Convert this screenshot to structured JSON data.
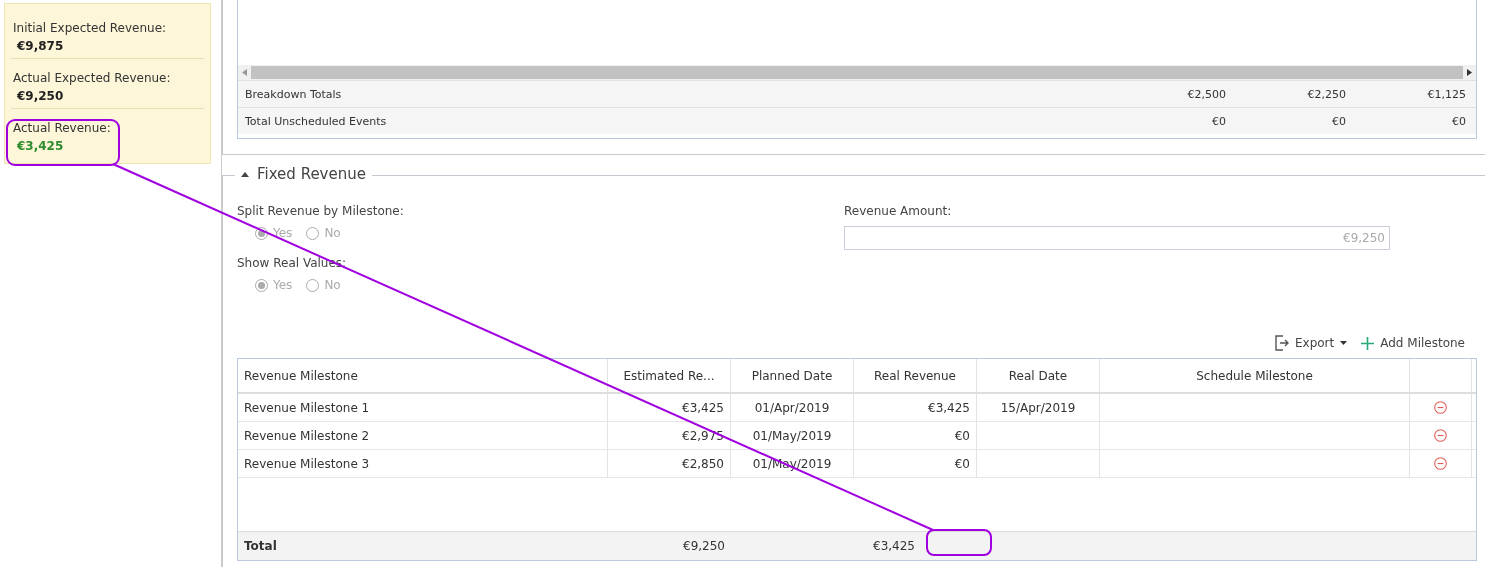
{
  "summary": [
    {
      "label": "Initial Expected Revenue:",
      "value": "€9,875",
      "highlight": false
    },
    {
      "label": "Actual Expected Revenue:",
      "value": "€9,250",
      "highlight": false
    },
    {
      "label": "Actual Revenue:",
      "value": "€3,425",
      "highlight": true
    }
  ],
  "breakdown": {
    "rows": [
      {
        "label": "Breakdown Totals",
        "values": [
          "€2,500",
          "€2,250",
          "€1,125"
        ]
      },
      {
        "label": "Total Unscheduled Events",
        "values": [
          "€0",
          "€0",
          "€0"
        ]
      }
    ]
  },
  "fixed_revenue": {
    "title": "Fixed Revenue",
    "expanded": true,
    "split_by_milestone": {
      "label": "Split Revenue by Milestone:",
      "disabled": true,
      "options": [
        {
          "label": "Yes",
          "selected": true
        },
        {
          "label": "No",
          "selected": false
        }
      ]
    },
    "show_real_values": {
      "label": "Show Real Values:",
      "disabled": true,
      "options": [
        {
          "label": "Yes",
          "selected": true
        },
        {
          "label": "No",
          "selected": false
        }
      ]
    },
    "revenue_amount": {
      "label": "Revenue Amount:",
      "value": "€9,250",
      "disabled": true
    },
    "toolbar": {
      "export": "Export",
      "add": "Add Milestone"
    },
    "table": {
      "columns": [
        "Revenue Milestone",
        "Estimated Re...",
        "Planned Date",
        "Real Revenue",
        "Real Date",
        "Schedule Milestone"
      ],
      "rows": [
        {
          "cells": [
            "Revenue Milestone 1",
            "€3,425",
            "01/Apr/2019",
            "€3,425",
            "15/Apr/2019",
            ""
          ]
        },
        {
          "cells": [
            "Revenue Milestone 2",
            "€2,975",
            "01/May/2019",
            "€0",
            "",
            ""
          ]
        },
        {
          "cells": [
            "Revenue Milestone 3",
            "€2,850",
            "01/May/2019",
            "€0",
            "",
            ""
          ]
        }
      ],
      "total": {
        "label": "Total",
        "estimated": "€9,250",
        "real": "€3,425"
      }
    }
  }
}
